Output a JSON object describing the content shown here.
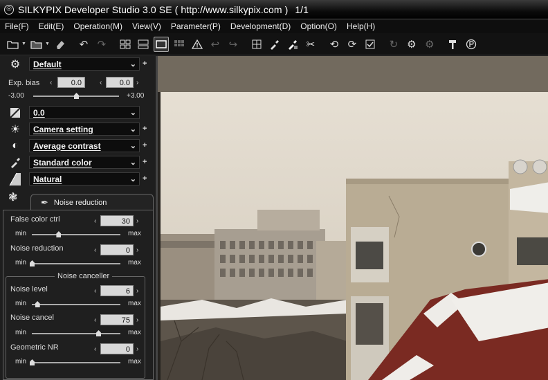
{
  "window": {
    "title": "SILKYPIX Developer Studio 3.0 SE ( http://www.silkypix.com )",
    "counter": "1/1"
  },
  "menu": [
    "File(F)",
    "Edit(E)",
    "Operation(M)",
    "View(V)",
    "Parameter(P)",
    "Development(D)",
    "Option(O)",
    "Help(H)"
  ],
  "toolbar": {
    "icons": [
      "open-folder-icon",
      "browse-folder-icon",
      "eraser-icon",
      "undo-icon",
      "redo-icon",
      "grid-view-icon",
      "split-view-icon",
      "single-view-icon",
      "thumbnail-view-icon",
      "warning-icon",
      "back-icon",
      "forward-icon",
      "crop-icon",
      "dropper-icon",
      "dropper-gray-icon",
      "scissors-icon",
      "rotate-left-icon",
      "rotate-right-icon",
      "check-icon",
      "refresh-icon",
      "develop-icon",
      "develop-all-icon",
      "hammer-icon",
      "logo-icon"
    ]
  },
  "panel": {
    "taste": {
      "value": "Default"
    },
    "exposure": {
      "label": "Exp. bias",
      "value1": "0.0",
      "value2": "0.0",
      "min": "-3.00",
      "max": "+3.00",
      "level": 0.5
    },
    "tone": {
      "value": "0.0"
    },
    "white_balance": {
      "value": "Camera setting"
    },
    "contrast": {
      "value": "Average contrast"
    },
    "color": {
      "value": "Standard color"
    },
    "sharpness": {
      "value": "Natural"
    },
    "subtab": {
      "label": "Noise reduction"
    },
    "false_color": {
      "label": "False color ctrl",
      "value": "30",
      "min": "min",
      "max": "max",
      "level": 0.3
    },
    "noise_reduction": {
      "label": "Noise reduction",
      "value": "0",
      "min": "min",
      "max": "max",
      "level": 0.0
    },
    "canceller": {
      "title": "Noise canceller",
      "noise_level": {
        "label": "Noise level",
        "value": "6",
        "min": "min",
        "max": "max",
        "level": 0.06
      },
      "noise_cancel": {
        "label": "Noise cancel",
        "value": "75",
        "min": "min",
        "max": "max",
        "level": 0.75
      },
      "geometric": {
        "label": "Geometric NR",
        "value": "0",
        "min": "min",
        "max": "max",
        "level": 0.0
      }
    }
  },
  "colors": {
    "accent": "#d8d8d8",
    "panel": "#1e1e1e",
    "sky": "#e2dbcd",
    "building": "#bfb29a",
    "roof": "#7a2a22"
  }
}
